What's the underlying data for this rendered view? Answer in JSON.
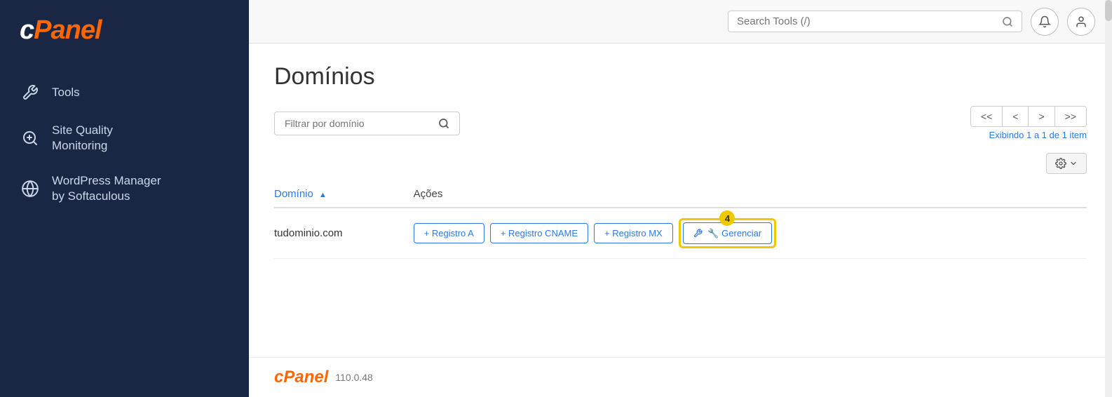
{
  "sidebar": {
    "logo": "cPanel",
    "items": [
      {
        "id": "tools",
        "label": "Tools",
        "icon": "tools-icon"
      },
      {
        "id": "site-quality",
        "label": "Site Quality\nMonitoring",
        "label_line1": "Site Quality",
        "label_line2": "Monitoring",
        "icon": "site-quality-icon"
      },
      {
        "id": "wordpress-manager",
        "label_line1": "WordPress Manager",
        "label_line2": "by Softaculous",
        "icon": "wordpress-icon"
      }
    ]
  },
  "header": {
    "search_placeholder": "Search Tools (/)"
  },
  "page": {
    "title": "Domínios",
    "filter_placeholder": "Filtrar por domínio",
    "pagination_info": "Exibindo 1 a 1 de 1 item",
    "pagination_buttons": [
      "<<",
      "<",
      ">",
      ">>"
    ],
    "table": {
      "columns": [
        {
          "id": "dominio",
          "label": "Domínio",
          "sortable": true
        },
        {
          "id": "acoes",
          "label": "Ações",
          "sortable": false
        }
      ],
      "rows": [
        {
          "domain": "tudominio.com",
          "actions": [
            {
              "id": "registro-a",
              "label": "+ Registro A"
            },
            {
              "id": "registro-cname",
              "label": "+ Registro CNAME"
            },
            {
              "id": "registro-mx",
              "label": "+ Registro MX"
            },
            {
              "id": "gerenciar",
              "label": "🔧 Gerenciar",
              "highlighted": true
            }
          ]
        }
      ]
    },
    "badge_number": "4"
  },
  "footer": {
    "logo": "cPanel",
    "version": "110.0.48"
  }
}
